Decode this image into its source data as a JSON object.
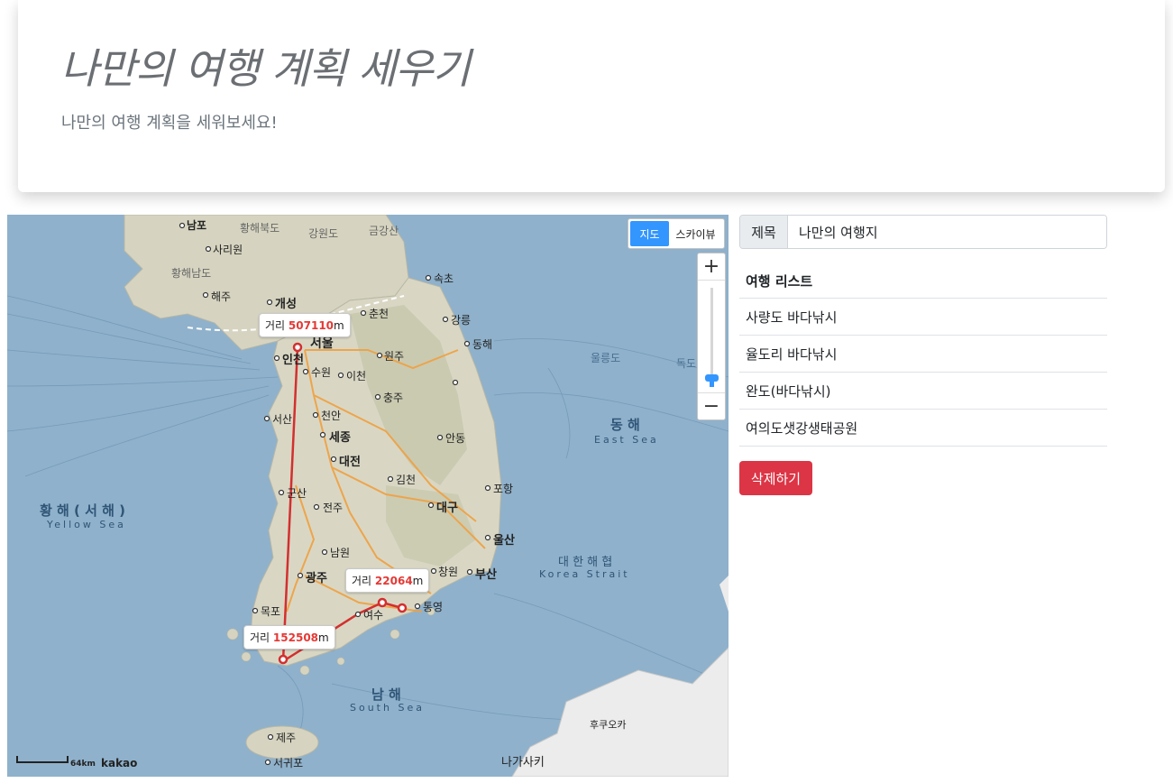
{
  "header": {
    "title": "나만의 여행 계획 세우기",
    "subtitle": "나만의 여행 계획을 세워보세요!"
  },
  "map": {
    "type_buttons": {
      "map": "지도",
      "skyview": "스카이뷰"
    },
    "zoom": {
      "in": "+",
      "out": "−"
    },
    "distances": [
      {
        "label": "거리",
        "value": "507110",
        "unit": "m"
      },
      {
        "label": "거리",
        "value": "22064",
        "unit": "m"
      },
      {
        "label": "거리",
        "value": "152508",
        "unit": "m"
      }
    ],
    "scale": "64km",
    "brand": "kakao",
    "labels": {
      "seoul": "서울",
      "incheon": "인천",
      "suwon": "수원",
      "icheon": "이천",
      "gaeseong": "개성",
      "chuncheon": "춘천",
      "gangneung": "강릉",
      "sokcho": "속초",
      "wonju": "원주",
      "chungju": "충주",
      "cheonan": "천안",
      "sejong": "세종",
      "daejeon": "대전",
      "seosan": "서산",
      "gimcheon": "김천",
      "andong": "안동",
      "pohang": "포항",
      "daegu": "대구",
      "ulsan": "울산",
      "busan": "부산",
      "changwon": "창원",
      "tongyeong": "통영",
      "yeosu": "여수",
      "gwangju": "광주",
      "jeonju": "전주",
      "namwon": "남원",
      "mokpo": "목포",
      "gunsan": "군산",
      "jeju": "제주",
      "seogwipo": "서귀포",
      "donghae": "동해",
      "east_sea": "동 해",
      "east_sea_en": "East Sea",
      "yellow_sea": "황 해 ( 서 해 )",
      "yellow_sea_en": "Yellow Sea",
      "south_sea": "남 해",
      "south_sea_en": "South Sea",
      "korea_strait": "대 한 해 협",
      "korea_strait_en": "Korea Strait",
      "ulleungdo": "울릉도",
      "dokdo": "독도",
      "nampo": "남포",
      "sariwon": "사리원",
      "haeju": "해주",
      "hwanghaebukdo": "황해북도",
      "hwanghaenamdo": "황해남도",
      "gangwondo": "강원도",
      "geumgangsan": "금강산",
      "fukuoka": "후쿠오카",
      "nagasaki": "나가사키"
    }
  },
  "form": {
    "title_label": "제목",
    "title_value": "나만의 여행지"
  },
  "list": {
    "header": "여행 리스트",
    "items": [
      "사량도 바다낚시",
      "율도리 바다낚시",
      "완도(바다낚시)",
      "여의도샛강생태공원"
    ]
  },
  "delete_button": "삭제하기",
  "colors": {
    "route": "#d32f2f",
    "primary": "#3396ff",
    "danger": "#dc3545"
  }
}
